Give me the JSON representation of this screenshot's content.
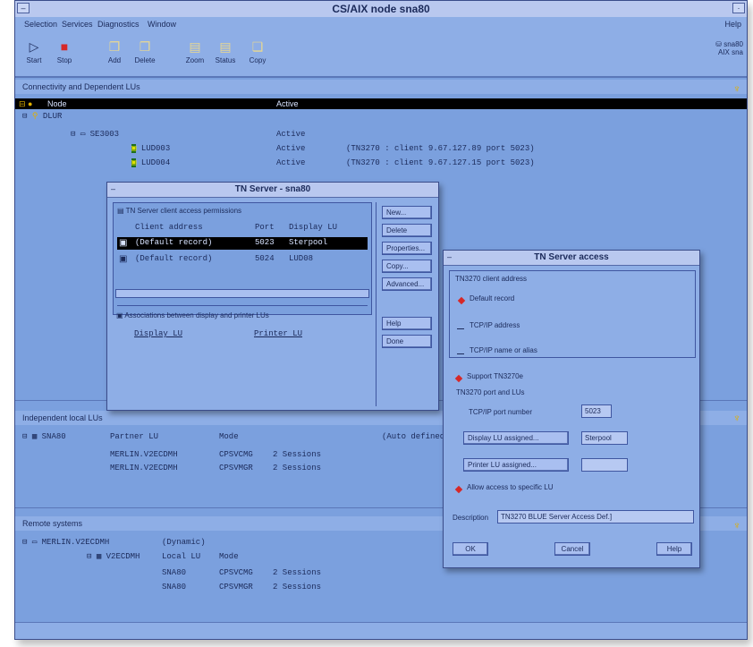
{
  "window": {
    "title": "CS/AIX node sna80"
  },
  "menu": [
    "Selection",
    "Services",
    "Diagnostics",
    "Window"
  ],
  "menu_right": "Help",
  "toolbar": [
    {
      "label": "Start",
      "icon": "play-icon"
    },
    {
      "label": "Stop",
      "icon": "stop-icon"
    },
    {
      "label": "Add",
      "icon": "add-icon"
    },
    {
      "label": "Delete",
      "icon": "delete-icon"
    },
    {
      "label": "Zoom",
      "icon": "zoom-icon"
    },
    {
      "label": "Status",
      "icon": "status-icon"
    },
    {
      "label": "Copy",
      "icon": "copy-icon"
    }
  ],
  "toolbar_right": {
    "line1": "sna80",
    "line2": "AIX sna"
  },
  "connectivity": {
    "title": "Connectivity and Dependent LUs",
    "header_node": "Node",
    "header_status": "Active",
    "tree": [
      {
        "name": "DLUR",
        "status": ""
      },
      {
        "name": "SE3003",
        "status": "Active"
      },
      {
        "name": "LUD003",
        "status": "Active",
        "detail": "(TN3270 : client 9.67.127.89 port 5023)"
      },
      {
        "name": "LUD004",
        "status": "Active",
        "detail": "(TN3270 : client 9.67.127.15 port 5023)"
      }
    ]
  },
  "independent": {
    "title": "Independent local LUs",
    "lu": "SNA80",
    "col_partner": "Partner LU",
    "col_mode": "Mode",
    "auto": "(Auto defined)",
    "rows": [
      {
        "partner": "MERLIN.V2ECDMH",
        "mode": "CPSVCMG",
        "sessions": "2 Sessions"
      },
      {
        "partner": "MERLIN.V2ECDMH",
        "mode": "CPSVMGR",
        "sessions": "2 Sessions"
      }
    ]
  },
  "remote": {
    "title": "Remote systems",
    "system": "MERLIN.V2ECDMH",
    "dynamic": "(Dynamic)",
    "sub": "V2ECDMH",
    "col_local": "Local LU",
    "col_mode": "Mode",
    "rows": [
      {
        "lu": "SNA80",
        "mode": "CPSVCMG",
        "sessions": "2 Sessions"
      },
      {
        "lu": "SNA80",
        "mode": "CPSVMGR",
        "sessions": "2 Sessions"
      }
    ]
  },
  "tn_server": {
    "title": "TN Server - sna80",
    "section1": "TN Server client access permissions",
    "col_client": "Client address",
    "col_port": "Port",
    "col_display": "Display LU",
    "rows": [
      {
        "client": "(Default record)",
        "port": "5023",
        "display": "Sterpool",
        "selected": true
      },
      {
        "client": "(Default record)",
        "port": "5024",
        "display": "LUD08",
        "selected": false
      }
    ],
    "section2": "Associations between display and printer LUs",
    "col_display_lu": "Display LU",
    "col_printer_lu": "Printer LU",
    "buttons": [
      "New...",
      "Delete",
      "Properties...",
      "Copy...",
      "Advanced..."
    ],
    "buttons2": [
      "Help",
      "Done"
    ]
  },
  "tn_access": {
    "title": "TN Server access",
    "group1": "TN3270 client address",
    "opt_default": "Default record",
    "opt_tcpip_addr": "TCP/IP address",
    "opt_tcpip_name": "TCP/IP name or alias",
    "support": "Support TN3270e",
    "port_group": "TN3270 port and LUs",
    "port_label": "TCP/IP port number",
    "port_value": "5023",
    "display_btn": "Display LU assigned...",
    "display_value": "Sterpool",
    "printer_btn": "Printer LU assigned...",
    "printer_value": "",
    "allow": "Allow access to specific LU",
    "desc_label": "Description",
    "desc_value": "TN3270 BLUE Server Access Def.]",
    "ok": "OK",
    "cancel": "Cancel",
    "help": "Help"
  }
}
